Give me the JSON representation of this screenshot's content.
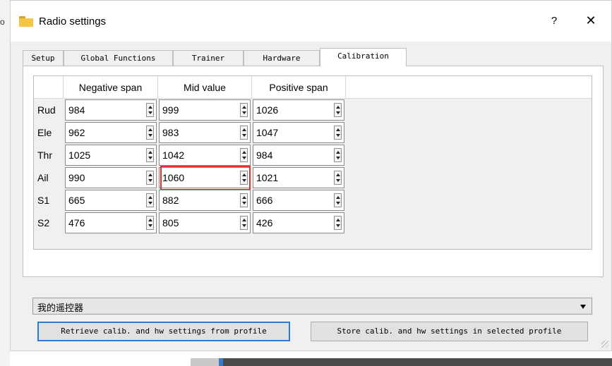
{
  "edge": {
    "char": "o"
  },
  "window": {
    "title": "Radio settings",
    "help_label": "?",
    "close_label": "✕",
    "icon": "folder-icon"
  },
  "tabs": [
    {
      "label": "Setup",
      "active": false
    },
    {
      "label": "Global Functions",
      "active": false
    },
    {
      "label": "Trainer",
      "active": false
    },
    {
      "label": "Hardware",
      "active": false
    },
    {
      "label": "Calibration",
      "active": true
    }
  ],
  "calibration": {
    "columns": [
      "Negative span",
      "Mid value",
      "Positive span"
    ],
    "rows": [
      {
        "label": "Rud",
        "values": [
          "984",
          "999",
          "1026"
        ]
      },
      {
        "label": "Ele",
        "values": [
          "962",
          "983",
          "1047"
        ]
      },
      {
        "label": "Thr",
        "values": [
          "1025",
          "1042",
          "984"
        ]
      },
      {
        "label": "Ail",
        "values": [
          "990",
          "1060",
          "1021"
        ]
      },
      {
        "label": "S1",
        "values": [
          "665",
          "882",
          "666"
        ]
      },
      {
        "label": "S2",
        "values": [
          "476",
          "805",
          "426"
        ]
      }
    ],
    "highlight_color": "#e03030"
  },
  "profile": {
    "selected": "我的遥控器"
  },
  "buttons": {
    "retrieve": "Retrieve calib. and hw settings from profile",
    "store": "Store calib. and hw settings in selected profile"
  },
  "colors": {
    "focus": "#2b7bd6",
    "window_bg": "#f0f0f0"
  }
}
